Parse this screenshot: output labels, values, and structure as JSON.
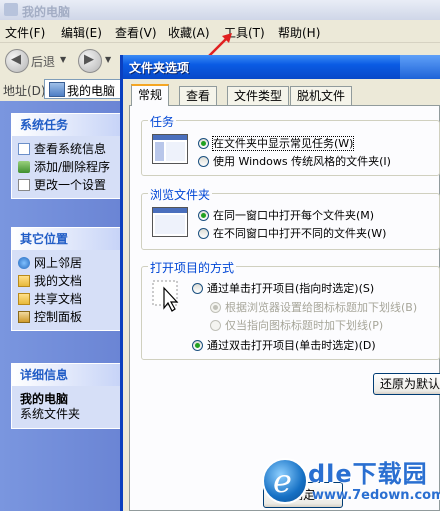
{
  "background_window": {
    "title": "我的电脑",
    "menu": [
      "文件(F)",
      "编辑(E)",
      "查看(V)",
      "收藏(A)",
      "工具(T)",
      "帮助(H)"
    ],
    "toolbar": {
      "back_label": "后退"
    },
    "address": {
      "label": "地址(D)",
      "value": "我的电脑"
    },
    "task_pane": {
      "system_tasks": {
        "title": "系统任务",
        "items": [
          "查看系统信息",
          "添加/删除程序",
          "更改一个设置"
        ]
      },
      "other_places": {
        "title": "其它位置",
        "items": [
          "网上邻居",
          "我的文档",
          "共享文档",
          "控制面板"
        ]
      },
      "details": {
        "title": "详细信息",
        "name": "我的电脑",
        "type": "系统文件夹"
      }
    }
  },
  "dialog": {
    "title": "文件夹选项",
    "tabs": [
      "常规",
      "查看",
      "文件类型",
      "脱机文件"
    ],
    "active_tab": "常规",
    "groups": {
      "tasks": {
        "legend": "任务",
        "options": [
          {
            "label": "在文件夹中显示常见任务(W)",
            "checked": true
          },
          {
            "label": "使用 Windows 传统风格的文件夹(I)",
            "checked": false
          }
        ]
      },
      "browse": {
        "legend": "浏览文件夹",
        "options": [
          {
            "label": "在同一窗口中打开每个文件夹(M)",
            "checked": true
          },
          {
            "label": "在不同窗口中打开不同的文件夹(W)",
            "checked": false
          }
        ]
      },
      "click": {
        "legend": "打开项目的方式",
        "options": [
          {
            "label": "通过单击打开项目(指向时选定)(S)",
            "checked": false
          },
          {
            "label": "根据浏览器设置给图标标题加下划线(B)",
            "checked": true,
            "disabled": true
          },
          {
            "label": "仅当指向图标标题时加下划线(P)",
            "checked": false,
            "disabled": true
          },
          {
            "label": "通过双击打开项目(单击时选定)(D)",
            "checked": true
          }
        ]
      }
    },
    "restore_button": "还原为默认值",
    "ok_button": "确定"
  },
  "watermark": {
    "text": "dle下载园",
    "url": "www.7edown.com"
  },
  "colors": {
    "accent_title": "#0a5be4",
    "task_pane": "#7a96df",
    "annotation_red": "#e02020"
  }
}
